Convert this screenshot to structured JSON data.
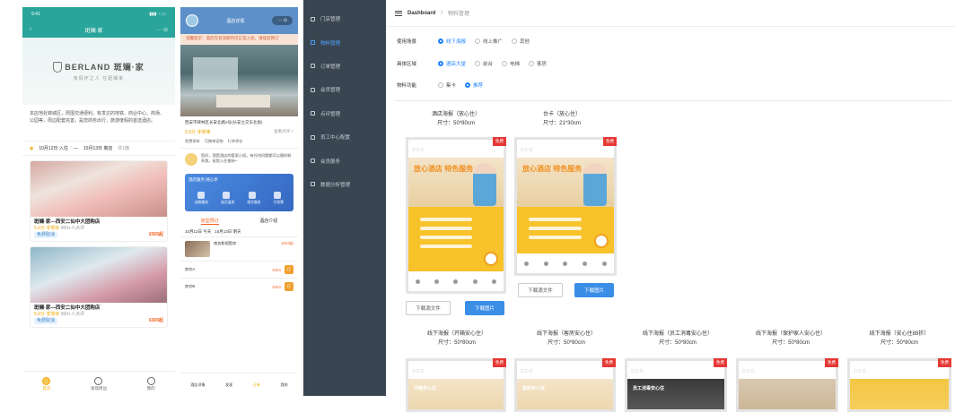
{
  "phone1": {
    "status_time": "9:41",
    "nav_title": "斑斓·家",
    "nav_actions": "··· ⊙",
    "brand_name": "BERLAND 斑斓·家",
    "slogan": "有情怀之人 住斑斓家",
    "description": "本店地处锦城区，周围交通便利，有发达的地铁、商业中心、商场、公园等，周边配套完善，是您商务出行、旅游度假的首选酒店。",
    "checkin": "10月12日 入住",
    "checkout": "10月13日 离店",
    "nights": "共1晚",
    "rooms": [
      {
        "title": "斑斓·家—西安二仙中大团购店",
        "score": "5.0分 非常好",
        "reviews": "900+人点评",
        "tag": "免费取消",
        "price": "¥365起"
      },
      {
        "title": "斑斓·家—西安二仙中大团购店",
        "score": "5.0分 非常好",
        "reviews": "900+人点评",
        "tag": "免费取消",
        "price": "¥365起"
      }
    ],
    "tabs": [
      {
        "label": "首页"
      },
      {
        "label": "发现周边"
      },
      {
        "label": "我的"
      }
    ]
  },
  "phone2": {
    "top_title": "酒店详情",
    "top_pill": "··· ⊙",
    "notice": "温馨提示：酒店在有效期内可正常入住，请提前预订",
    "address": "西安市碑林区长安北路2号(长安立交东北角)",
    "score": "5.0分 非常棒",
    "score_link": "查看点评 >",
    "facilities": [
      "免费停车",
      "可携带宠物",
      "行李寄存"
    ],
    "message": "您好，我是酒店的管家小斑，有任何问题都可以随时联系我，祝您入住愉快~",
    "blue_title": "酒店服务 随心享",
    "blue_items": [
      "送物服务",
      "延迟退房",
      "续住服务",
      "开发票"
    ],
    "tab_on": "房型预订",
    "tab_off": "酒店介绍",
    "date_in": "10月12日 今天",
    "date_out": "10月13日 明天",
    "room_name": "商务影视套房",
    "room_price": "¥424起",
    "plans": [
      {
        "name": "房价A",
        "price": "¥424",
        "btn": "订"
      },
      {
        "name": "房价B",
        "price": "¥424",
        "btn": "订"
      }
    ],
    "tabs": [
      "酒店详情",
      "发现",
      "订单",
      "我的"
    ]
  },
  "sidebar": {
    "items": [
      {
        "label": "门店管理"
      },
      {
        "label": "物料管理"
      },
      {
        "label": "订单管理"
      },
      {
        "label": "会员管理"
      },
      {
        "label": "点评管理"
      },
      {
        "label": "员工中心配置"
      },
      {
        "label": "会员服务"
      },
      {
        "label": "数据分析管理"
      }
    ]
  },
  "header": {
    "crumb_root": "Dashboard",
    "crumb_sep": "/",
    "crumb_current": "物料管理"
  },
  "filters": [
    {
      "label": "使用场景",
      "options": [
        "线下海报",
        "线上推广",
        "其他"
      ],
      "selected": 0
    },
    {
      "label": "具体区域",
      "options": [
        "酒店大堂",
        "前台",
        "电梯",
        "客房"
      ],
      "selected": 0
    },
    {
      "label": "物料功能",
      "options": [
        "集卡",
        "推荐"
      ],
      "selected": 1
    }
  ],
  "top_posters": [
    {
      "title": "酒店海报（放心住）",
      "size": "尺寸：50*80cm",
      "badge": "免费",
      "headline": "放心酒店 特色服务"
    },
    {
      "title": "台卡（放心住）",
      "size": "尺寸：21*30cm",
      "badge": "免费",
      "headline": "放心酒店 特色服务"
    }
  ],
  "download_file_label": "下载源文件",
  "download_image_label": "下载图片",
  "bottom_posters": [
    {
      "title": "线下海报（开箱安心住）",
      "size": "尺寸：50*80cm",
      "badge": "免费",
      "headline": "开箱安心住"
    },
    {
      "title": "线下海报（客房安心住）",
      "size": "尺寸：50*80cm",
      "badge": "免费",
      "headline": "客房安心住"
    },
    {
      "title": "线下海报（员工消毒安心住）",
      "size": "尺寸：50*80cm",
      "badge": "免费",
      "headline": "员工消毒安心住"
    },
    {
      "title": "线下海报（保护家人安心住）",
      "size": "尺寸：50*80cm",
      "badge": "免费",
      "headline": ""
    },
    {
      "title": "线下海报（安心住88折）",
      "size": "尺寸：50*80cm",
      "badge": "免费",
      "headline": ""
    }
  ]
}
